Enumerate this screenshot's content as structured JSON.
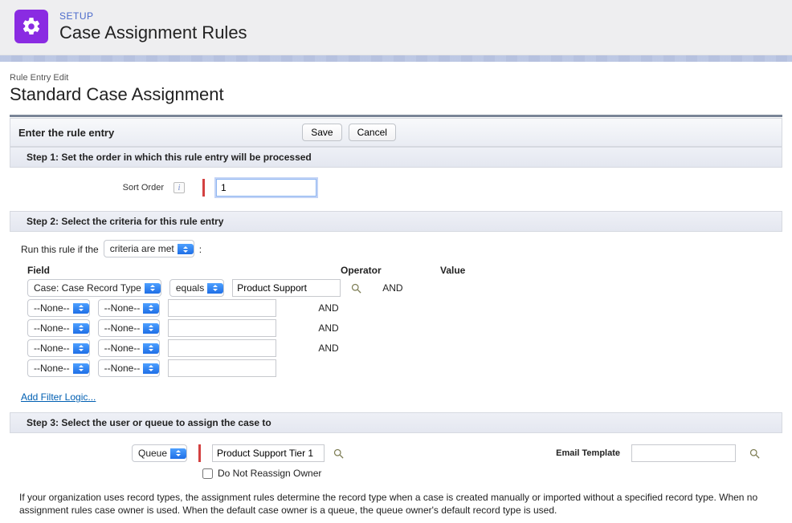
{
  "header": {
    "subtitle": "SETUP",
    "title": "Case Assignment Rules"
  },
  "breadcrumb": "Rule Entry Edit",
  "page_title": "Standard Case Assignment",
  "panel1": {
    "title": "Enter the rule entry",
    "save": "Save",
    "cancel": "Cancel"
  },
  "step1": {
    "heading": "Step 1: Set the order in which this rule entry will be processed",
    "label": "Sort Order",
    "value": "1"
  },
  "step2": {
    "heading": "Step 2: Select the criteria for this rule entry",
    "run_prefix": "Run this rule if the",
    "run_mode": "criteria are met",
    "col_field": "Field",
    "col_operator": "Operator",
    "col_value": "Value",
    "rows": [
      {
        "field": "Case: Case Record Type",
        "operator": "equals",
        "value": "Product Support",
        "and": "AND",
        "lookup": true
      },
      {
        "field": "--None--",
        "operator": "--None--",
        "value": "",
        "and": "AND",
        "lookup": false
      },
      {
        "field": "--None--",
        "operator": "--None--",
        "value": "",
        "and": "AND",
        "lookup": false
      },
      {
        "field": "--None--",
        "operator": "--None--",
        "value": "",
        "and": "AND",
        "lookup": false
      },
      {
        "field": "--None--",
        "operator": "--None--",
        "value": "",
        "and": "",
        "lookup": false
      }
    ],
    "add_filter": "Add Filter Logic..."
  },
  "step3": {
    "heading": "Step 3: Select the user or queue to assign the case to",
    "assignee_type": "Queue",
    "assignee_value": "Product Support Tier 1",
    "email_template_label": "Email Template",
    "email_template_value": "",
    "checkbox_label": "Do Not Reassign Owner",
    "checkbox_checked": false
  },
  "footer": "If your organization uses record types, the assignment rules determine the record type when a case is created manually or imported without a specified record type. When no assignment rules case owner is used. When the default case owner is a queue, the queue owner's default record type is used."
}
